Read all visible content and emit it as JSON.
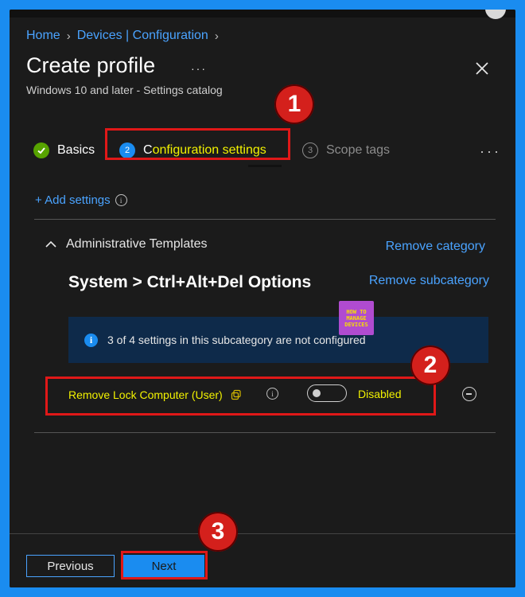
{
  "breadcrumb": {
    "home": "Home",
    "devices": "Devices | Configuration"
  },
  "header": {
    "title": "Create profile",
    "more": "···",
    "subtitle": "Windows 10 and later - Settings catalog"
  },
  "tabs": [
    {
      "label": "Basics",
      "state": "complete"
    },
    {
      "number": "2",
      "label_prefix": "C",
      "label_highlight": "onfiguration settings",
      "state": "active"
    },
    {
      "number": "3",
      "label": "Scope tags",
      "state": "inactive"
    }
  ],
  "tabs_more": "···",
  "add_settings": "+ Add settings",
  "category": {
    "name": "Administrative Templates",
    "remove_label": "Remove category"
  },
  "subcategory": {
    "name": "System > Ctrl+Alt+Del Options",
    "remove_label": "Remove subcategory"
  },
  "logo": {
    "line1": "HOW TO",
    "line2": "MANAGE",
    "line3": "DEVICES"
  },
  "info_banner": {
    "text": "3 of 4 settings in this subcategory are not configured"
  },
  "setting": {
    "name": "Remove Lock Computer (User)",
    "state": "Disabled",
    "enabled": false
  },
  "annotations": {
    "badge1": "1",
    "badge2": "2",
    "badge3": "3"
  },
  "footer": {
    "previous": "Previous",
    "next": "Next"
  },
  "colors": {
    "accent": "#1a8cf0",
    "highlight": "#f2f200",
    "annotation_red": "#e01818",
    "success": "#57a300"
  }
}
